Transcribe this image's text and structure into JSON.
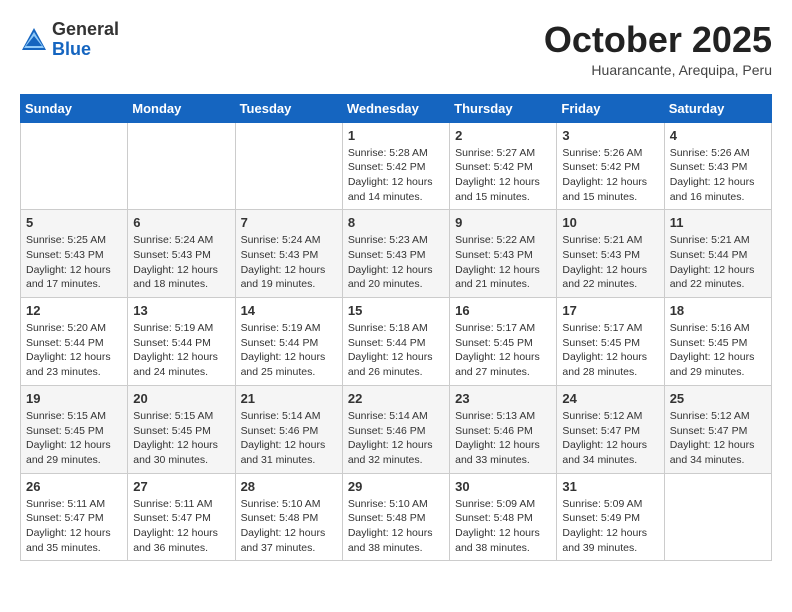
{
  "header": {
    "logo_general": "General",
    "logo_blue": "Blue",
    "month_year": "October 2025",
    "location": "Huarancante, Arequipa, Peru"
  },
  "calendar": {
    "days_of_week": [
      "Sunday",
      "Monday",
      "Tuesday",
      "Wednesday",
      "Thursday",
      "Friday",
      "Saturday"
    ],
    "weeks": [
      [
        {
          "day": "",
          "info": ""
        },
        {
          "day": "",
          "info": ""
        },
        {
          "day": "",
          "info": ""
        },
        {
          "day": "1",
          "info": "Sunrise: 5:28 AM\nSunset: 5:42 PM\nDaylight: 12 hours\nand 14 minutes."
        },
        {
          "day": "2",
          "info": "Sunrise: 5:27 AM\nSunset: 5:42 PM\nDaylight: 12 hours\nand 15 minutes."
        },
        {
          "day": "3",
          "info": "Sunrise: 5:26 AM\nSunset: 5:42 PM\nDaylight: 12 hours\nand 15 minutes."
        },
        {
          "day": "4",
          "info": "Sunrise: 5:26 AM\nSunset: 5:43 PM\nDaylight: 12 hours\nand 16 minutes."
        }
      ],
      [
        {
          "day": "5",
          "info": "Sunrise: 5:25 AM\nSunset: 5:43 PM\nDaylight: 12 hours\nand 17 minutes."
        },
        {
          "day": "6",
          "info": "Sunrise: 5:24 AM\nSunset: 5:43 PM\nDaylight: 12 hours\nand 18 minutes."
        },
        {
          "day": "7",
          "info": "Sunrise: 5:24 AM\nSunset: 5:43 PM\nDaylight: 12 hours\nand 19 minutes."
        },
        {
          "day": "8",
          "info": "Sunrise: 5:23 AM\nSunset: 5:43 PM\nDaylight: 12 hours\nand 20 minutes."
        },
        {
          "day": "9",
          "info": "Sunrise: 5:22 AM\nSunset: 5:43 PM\nDaylight: 12 hours\nand 21 minutes."
        },
        {
          "day": "10",
          "info": "Sunrise: 5:21 AM\nSunset: 5:43 PM\nDaylight: 12 hours\nand 22 minutes."
        },
        {
          "day": "11",
          "info": "Sunrise: 5:21 AM\nSunset: 5:44 PM\nDaylight: 12 hours\nand 22 minutes."
        }
      ],
      [
        {
          "day": "12",
          "info": "Sunrise: 5:20 AM\nSunset: 5:44 PM\nDaylight: 12 hours\nand 23 minutes."
        },
        {
          "day": "13",
          "info": "Sunrise: 5:19 AM\nSunset: 5:44 PM\nDaylight: 12 hours\nand 24 minutes."
        },
        {
          "day": "14",
          "info": "Sunrise: 5:19 AM\nSunset: 5:44 PM\nDaylight: 12 hours\nand 25 minutes."
        },
        {
          "day": "15",
          "info": "Sunrise: 5:18 AM\nSunset: 5:44 PM\nDaylight: 12 hours\nand 26 minutes."
        },
        {
          "day": "16",
          "info": "Sunrise: 5:17 AM\nSunset: 5:45 PM\nDaylight: 12 hours\nand 27 minutes."
        },
        {
          "day": "17",
          "info": "Sunrise: 5:17 AM\nSunset: 5:45 PM\nDaylight: 12 hours\nand 28 minutes."
        },
        {
          "day": "18",
          "info": "Sunrise: 5:16 AM\nSunset: 5:45 PM\nDaylight: 12 hours\nand 29 minutes."
        }
      ],
      [
        {
          "day": "19",
          "info": "Sunrise: 5:15 AM\nSunset: 5:45 PM\nDaylight: 12 hours\nand 29 minutes."
        },
        {
          "day": "20",
          "info": "Sunrise: 5:15 AM\nSunset: 5:45 PM\nDaylight: 12 hours\nand 30 minutes."
        },
        {
          "day": "21",
          "info": "Sunrise: 5:14 AM\nSunset: 5:46 PM\nDaylight: 12 hours\nand 31 minutes."
        },
        {
          "day": "22",
          "info": "Sunrise: 5:14 AM\nSunset: 5:46 PM\nDaylight: 12 hours\nand 32 minutes."
        },
        {
          "day": "23",
          "info": "Sunrise: 5:13 AM\nSunset: 5:46 PM\nDaylight: 12 hours\nand 33 minutes."
        },
        {
          "day": "24",
          "info": "Sunrise: 5:12 AM\nSunset: 5:47 PM\nDaylight: 12 hours\nand 34 minutes."
        },
        {
          "day": "25",
          "info": "Sunrise: 5:12 AM\nSunset: 5:47 PM\nDaylight: 12 hours\nand 34 minutes."
        }
      ],
      [
        {
          "day": "26",
          "info": "Sunrise: 5:11 AM\nSunset: 5:47 PM\nDaylight: 12 hours\nand 35 minutes."
        },
        {
          "day": "27",
          "info": "Sunrise: 5:11 AM\nSunset: 5:47 PM\nDaylight: 12 hours\nand 36 minutes."
        },
        {
          "day": "28",
          "info": "Sunrise: 5:10 AM\nSunset: 5:48 PM\nDaylight: 12 hours\nand 37 minutes."
        },
        {
          "day": "29",
          "info": "Sunrise: 5:10 AM\nSunset: 5:48 PM\nDaylight: 12 hours\nand 38 minutes."
        },
        {
          "day": "30",
          "info": "Sunrise: 5:09 AM\nSunset: 5:48 PM\nDaylight: 12 hours\nand 38 minutes."
        },
        {
          "day": "31",
          "info": "Sunrise: 5:09 AM\nSunset: 5:49 PM\nDaylight: 12 hours\nand 39 minutes."
        },
        {
          "day": "",
          "info": ""
        }
      ]
    ]
  }
}
